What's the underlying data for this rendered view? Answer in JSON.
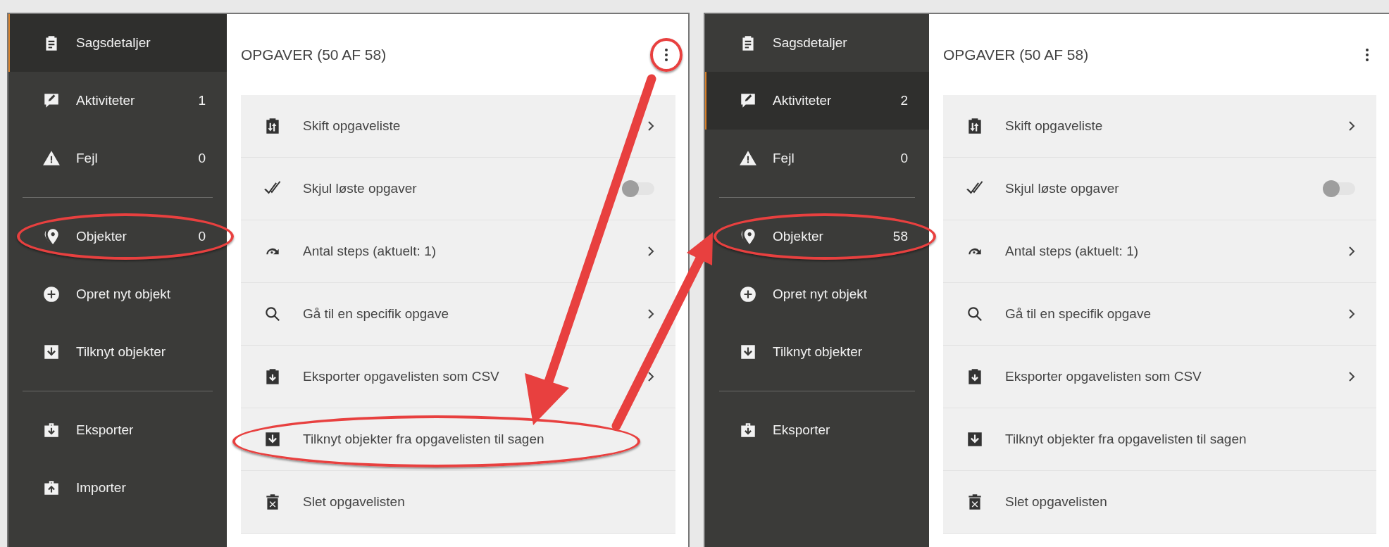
{
  "panels": [
    {
      "sidebar": {
        "groups": [
          [
            {
              "label": "Sagsdetaljer",
              "selected": true,
              "circled": false
            },
            {
              "label": "Aktiviteter",
              "count": "1",
              "selected": false,
              "circled": false
            },
            {
              "label": "Fejl",
              "count": "0",
              "selected": false,
              "circled": false
            }
          ],
          [
            {
              "label": "Objekter",
              "count": "0",
              "selected": false,
              "circled": true
            },
            {
              "label": "Opret nyt objekt",
              "selected": false,
              "circled": false
            },
            {
              "label": "Tilknyt objekter",
              "selected": false,
              "circled": false
            }
          ],
          [
            {
              "label": "Eksporter",
              "selected": false,
              "circled": false
            },
            {
              "label": "Importer",
              "selected": false,
              "circled": false
            }
          ]
        ]
      },
      "main": {
        "title": "OPGAVER (50 AF 58)",
        "menu_button": {
          "circled": true
        },
        "menu_items": [
          {
            "label": "Skift opgaveliste",
            "kind": "submenu",
            "circled": false
          },
          {
            "label": "Skjul løste opgaver",
            "kind": "toggle",
            "on": false,
            "circled": false
          },
          {
            "label": "Antal steps (aktuelt: 1)",
            "kind": "submenu",
            "circled": false
          },
          {
            "label": "Gå til en specifik opgave",
            "kind": "submenu",
            "circled": false
          },
          {
            "label": "Eksporter opgavelisten som CSV",
            "kind": "submenu",
            "circled": false
          },
          {
            "label": "Tilknyt objekter fra opgavelisten til sagen",
            "kind": "action",
            "circled": true
          },
          {
            "label": "Slet opgavelisten",
            "kind": "action",
            "circled": false
          }
        ]
      }
    },
    {
      "sidebar": {
        "groups": [
          [
            {
              "label": "Sagsdetaljer",
              "selected": false,
              "circled": false
            },
            {
              "label": "Aktiviteter",
              "count": "2",
              "selected": true,
              "circled": false
            },
            {
              "label": "Fejl",
              "count": "0",
              "selected": false,
              "circled": false
            }
          ],
          [
            {
              "label": "Objekter",
              "count": "58",
              "selected": false,
              "circled": true
            },
            {
              "label": "Opret nyt objekt",
              "selected": false,
              "circled": false
            },
            {
              "label": "Tilknyt objekter",
              "selected": false,
              "circled": false
            }
          ],
          [
            {
              "label": "Eksporter",
              "selected": false,
              "circled": false
            }
          ]
        ]
      },
      "main": {
        "title": "OPGAVER (50 AF 58)",
        "menu_button": {
          "circled": false
        },
        "menu_items": [
          {
            "label": "Skift opgaveliste",
            "kind": "submenu",
            "circled": false
          },
          {
            "label": "Skjul løste opgaver",
            "kind": "toggle",
            "on": false,
            "circled": false
          },
          {
            "label": "Antal steps (aktuelt: 1)",
            "kind": "submenu",
            "circled": false
          },
          {
            "label": "Gå til en specifik opgave",
            "kind": "submenu",
            "circled": false
          },
          {
            "label": "Eksporter opgavelisten som CSV",
            "kind": "submenu",
            "circled": false
          },
          {
            "label": "Tilknyt objekter fra opgavelisten til sagen",
            "kind": "action",
            "circled": false
          },
          {
            "label": "Slet opgavelisten",
            "kind": "action",
            "circled": false
          }
        ]
      }
    }
  ]
}
